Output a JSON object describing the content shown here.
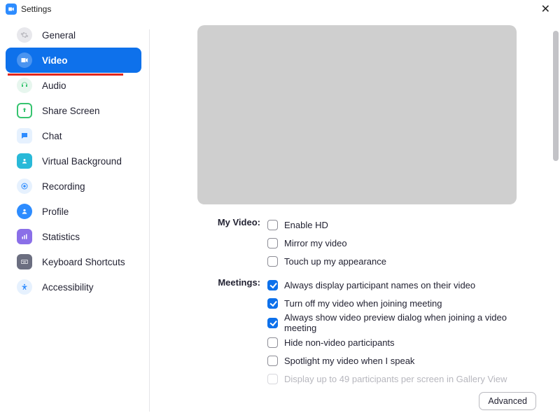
{
  "window": {
    "title": "Settings"
  },
  "sidebar": {
    "items": [
      {
        "label": "General"
      },
      {
        "label": "Video"
      },
      {
        "label": "Audio"
      },
      {
        "label": "Share Screen"
      },
      {
        "label": "Chat"
      },
      {
        "label": "Virtual Background"
      },
      {
        "label": "Recording"
      },
      {
        "label": "Profile"
      },
      {
        "label": "Statistics"
      },
      {
        "label": "Keyboard Shortcuts"
      },
      {
        "label": "Accessibility"
      }
    ],
    "active_index": 1
  },
  "main": {
    "sections": {
      "my_video": {
        "heading": "My Video:",
        "options": [
          {
            "label": "Enable HD",
            "checked": false
          },
          {
            "label": "Mirror my video",
            "checked": false
          },
          {
            "label": "Touch up my appearance",
            "checked": false
          }
        ]
      },
      "meetings": {
        "heading": "Meetings:",
        "options": [
          {
            "label": "Always display participant names on their video",
            "checked": true
          },
          {
            "label": "Turn off my video when joining meeting",
            "checked": true
          },
          {
            "label": "Always show video preview dialog when joining a video meeting",
            "checked": true
          },
          {
            "label": "Hide non-video participants",
            "checked": false
          },
          {
            "label": "Spotlight my video when I speak",
            "checked": false
          },
          {
            "label": "Display up to 49 participants per screen in Gallery View",
            "checked": false,
            "disabled": true
          }
        ]
      }
    },
    "advanced_label": "Advanced"
  },
  "colors": {
    "accent": "#0E71EB",
    "annotation": "#E1261C"
  }
}
